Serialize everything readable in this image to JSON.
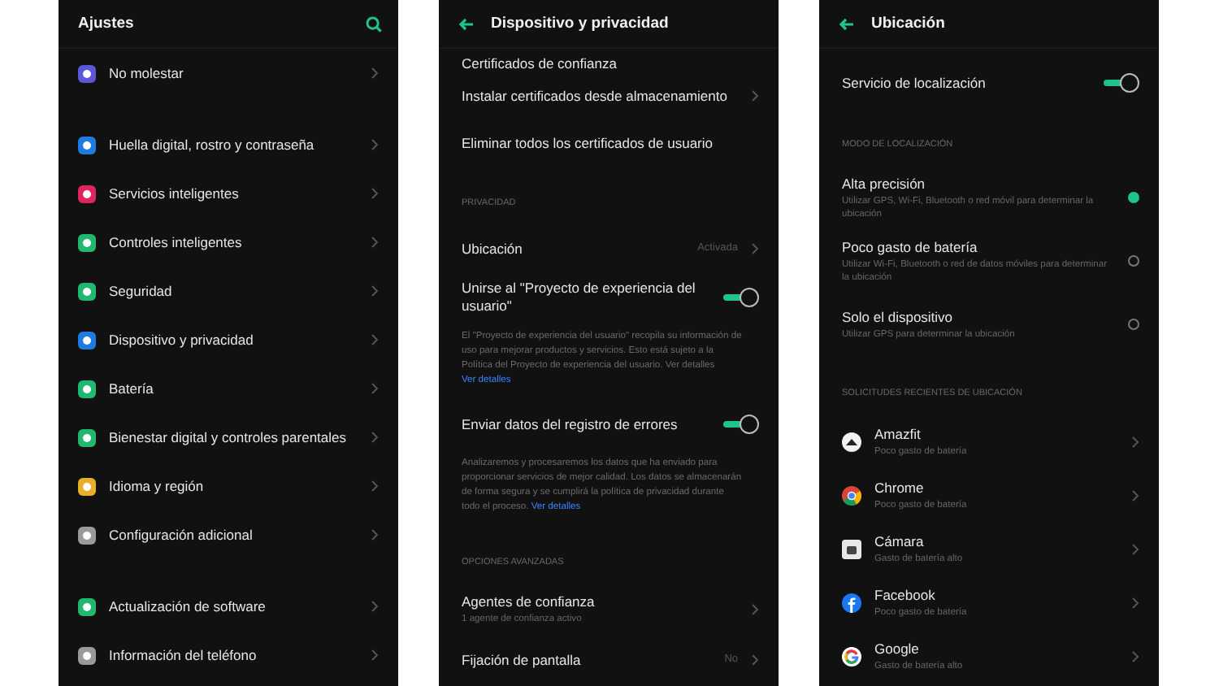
{
  "screens": [
    {
      "kind": "main",
      "title": "Ajustes",
      "sections": [
        {
          "rows": [
            {
              "kind": "nav",
              "label": "No molestar",
              "color": "#5b57d6"
            }
          ]
        },
        {
          "rows": [
            {
              "kind": "nav",
              "label": "Huella digital, rostro y contraseña",
              "color": "#1e7be0"
            },
            {
              "kind": "nav",
              "label": "Servicios inteligentes",
              "color": "#e0245e"
            },
            {
              "kind": "nav",
              "label": "Controles inteligentes",
              "color": "#1fb870"
            },
            {
              "kind": "nav",
              "label": "Seguridad",
              "color": "#1fb870"
            },
            {
              "kind": "nav",
              "label": "Dispositivo y privacidad",
              "color": "#1e7be0"
            },
            {
              "kind": "nav",
              "label": "Batería",
              "color": "#1fb870"
            },
            {
              "kind": "nav",
              "label": "Bienestar digital y controles parentales",
              "color": "#1fb870"
            },
            {
              "kind": "nav",
              "label": "Idioma y región",
              "color": "#e8b02a"
            },
            {
              "kind": "nav",
              "label": "Configuración adicional",
              "color": "#9a9a9a"
            }
          ]
        },
        {
          "rows": [
            {
              "kind": "nav",
              "label": "Actualización de software",
              "color": "#1fb870"
            },
            {
              "kind": "nav",
              "label": "Información del teléfono",
              "color": "#9a9a9a"
            }
          ]
        }
      ]
    },
    {
      "kind": "sub",
      "title": "Dispositivo y privacidad",
      "sections": [
        {
          "rows": [
            {
              "kind": "cut",
              "label": "Certificados de confianza"
            },
            {
              "kind": "link",
              "label": "Instalar certificados desde almacenamiento"
            },
            {
              "kind": "plain",
              "label": "Eliminar todos los certificados de usuario"
            }
          ]
        },
        {
          "header": "PRIVACIDAD",
          "rows": [
            {
              "kind": "link",
              "label": "Ubicación",
              "value": "Activada"
            },
            {
              "kind": "switch",
              "label": "Unirse al \"Proyecto de experiencia del usuario\"",
              "on": true
            },
            {
              "kind": "note",
              "text": "El \"Proyecto de experiencia del usuario\" recopila su información de uso para mejorar productos y servicios. Esto está sujeto a la Política del Proyecto de experiencia del usuario. Ver detalles",
              "link": "Ver detalles"
            },
            {
              "kind": "switch",
              "label": "Enviar datos del registro de errores",
              "on": true
            },
            {
              "kind": "note",
              "text": "Analizaremos y procesaremos los datos que ha enviado para proporcionar servicios de mejor calidad. Los datos se almacenarán de forma segura y se cumplirá la política de privacidad durante todo el proceso.",
              "link": "Ver detalles"
            }
          ]
        },
        {
          "header": "OPCIONES AVANZADAS",
          "rows": [
            {
              "kind": "link",
              "label": "Agentes de confianza",
              "sub": "1 agente de confianza activo"
            },
            {
              "kind": "link",
              "label": "Fijación de pantalla",
              "value": "No"
            }
          ]
        }
      ]
    },
    {
      "kind": "sub",
      "title": "Ubicación",
      "sections": [
        {
          "rows": [
            {
              "kind": "switch",
              "label": "Servicio de localización",
              "on": true
            }
          ]
        },
        {
          "header": "MODO DE LOCALIZACIÓN",
          "rows": [
            {
              "kind": "radio",
              "label": "Alta precisión",
              "sub": "Utilizar GPS, Wi-Fi, Bluetooth o red móvil para determinar la ubicación",
              "selected": true
            },
            {
              "kind": "radio",
              "label": "Poco gasto de batería",
              "sub": "Utilizar Wi-Fi, Bluetooth o red de datos móviles para determinar la ubicación",
              "selected": false
            },
            {
              "kind": "radio",
              "label": "Solo el dispositivo",
              "sub": "Utilizar GPS para determinar la ubicación",
              "selected": false
            }
          ]
        },
        {
          "header": "SOLICITUDES RECIENTES DE UBICACIÓN",
          "rows": [
            {
              "kind": "app",
              "label": "Amazfit",
              "sub": "Poco gasto de batería"
            },
            {
              "kind": "app",
              "label": "Chrome",
              "sub": "Poco gasto de batería"
            },
            {
              "kind": "app",
              "label": "Cámara",
              "sub": "Gasto de batería alto"
            },
            {
              "kind": "app",
              "label": "Facebook",
              "sub": "Poco gasto de batería"
            },
            {
              "kind": "app",
              "label": "Google",
              "sub": "Gasto de batería alto"
            }
          ]
        }
      ]
    }
  ]
}
